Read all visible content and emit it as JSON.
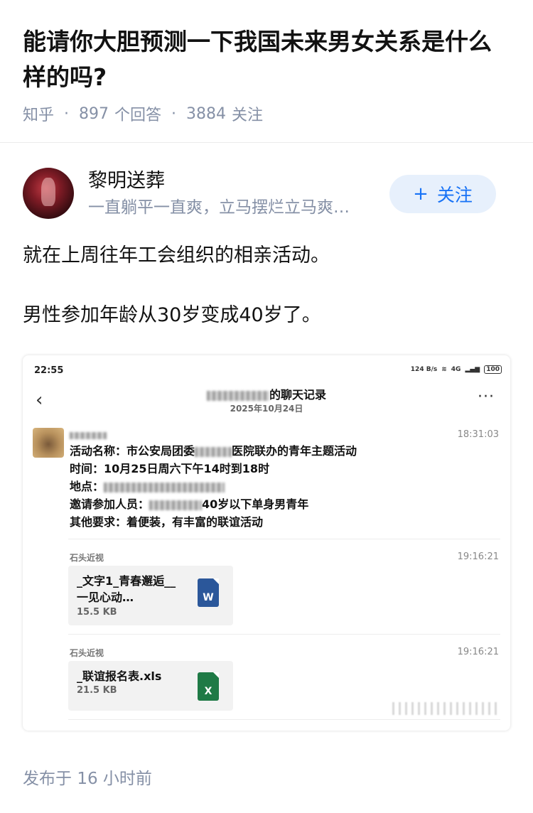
{
  "question": {
    "title": "能请你大胆预测一下我国未来男女关系是什么样的吗?",
    "site": "知乎",
    "answer_count": "897",
    "answer_label": "个回答",
    "follow_count": "3884",
    "follow_label": "关注"
  },
  "author": {
    "name": "黎明送葬",
    "bio": "一直躺平一直爽，立马摆烂立马爽…",
    "follow_button": "关注",
    "follow_plus": "+"
  },
  "answer": {
    "paragraphs": [
      "就在上周往年工会组织的相亲活动。",
      "男性参加年龄从30岁变成40岁了。"
    ]
  },
  "screenshot": {
    "status_time": "22:55",
    "status_network": "124 B/s",
    "status_signal": "4G",
    "battery": "100",
    "chat_title_suffix": "的聊天记录",
    "chat_date": "2025年10月24日",
    "back_icon": "chevron-left-icon",
    "more_icon": "more-dots-icon",
    "message": {
      "time": "18:31:03",
      "line1_prefix": "活动名称：市公安局团委",
      "line1_suffix": "医院联办的青年主题活动",
      "line2": "时间：10月25日周六下午14时到18时",
      "line3": "地点：",
      "line4_prefix": "邀请参加人员：",
      "line4_suffix": "40岁以下单身男青年",
      "line5": "其他要求：着便装，有丰富的联谊活动"
    },
    "files": [
      {
        "sender": "石头近视",
        "time": "19:16:21",
        "name": "_文字1_青春邂逅__一见心动…",
        "size": "15.5 KB",
        "icon": "word-file-icon",
        "icon_letter": "W",
        "color": "#2b579a"
      },
      {
        "sender": "石头近视",
        "time": "19:16:21",
        "name": "_联谊报名表.xls",
        "size": "21.5 KB",
        "icon": "excel-file-icon",
        "icon_letter": "X",
        "color": "#1f7a46"
      }
    ]
  },
  "footer": {
    "published_prefix": "发布于",
    "published_time": "16 小时前"
  },
  "colors": {
    "accent": "#1772f6",
    "meta_gray": "#8590a6",
    "follow_bg": "#e7f0fc"
  }
}
